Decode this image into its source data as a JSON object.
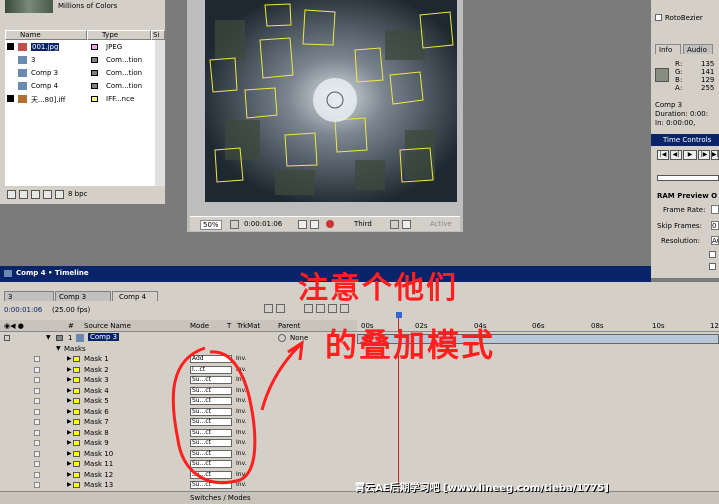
{
  "project": {
    "footage_info": "Millions of Colors",
    "col_name": "Name",
    "col_type": "Type",
    "col_size": "Si",
    "items": [
      {
        "name": "001.jpg",
        "type": "JPEG",
        "swatch": "#f0a0f0",
        "selected": true
      },
      {
        "name": "3",
        "type": "Com...tion",
        "swatch": "#808080"
      },
      {
        "name": "Comp 3",
        "type": "Com...tion",
        "swatch": "#808080"
      },
      {
        "name": "Comp 4",
        "type": "Com...tion",
        "swatch": "#808080"
      },
      {
        "name": "天...80].iff",
        "type": "IFF...nce",
        "swatch": "#f0f080"
      }
    ],
    "bpc": "8 bpc"
  },
  "comp": {
    "zoom": "50%",
    "timecode": "0:00:01:06",
    "resolution": "Third",
    "view": "Active"
  },
  "right": {
    "rotobezier": "RotoBezier",
    "tabs": [
      "Info",
      "Audio"
    ],
    "rgba": [
      {
        "ch": "R",
        "val": "135"
      },
      {
        "ch": "G",
        "val": "141"
      },
      {
        "ch": "B",
        "val": "129"
      },
      {
        "ch": "A",
        "val": "255"
      }
    ],
    "info_lines": [
      "Comp 3",
      "Duration: 0:00:",
      "In: 0:00:00,"
    ],
    "time_controls": "Time Controls",
    "ram_preview": "RAM Preview O",
    "frame_rate": "Frame Rate:",
    "skip_frames": "Skip Frames:",
    "skip_val": "0",
    "resolution": "Resolution:",
    "res_val": "Au"
  },
  "timeline": {
    "title": "Comp 4 • Timeline",
    "tabs": [
      "3",
      "Comp 3",
      "Comp 4"
    ],
    "timecode": "0:00:01:06",
    "fps": "(25.00 fps)",
    "headers": {
      "hash": "#",
      "source": "Source Name",
      "mode": "Mode",
      "t": "T",
      "trkmat": "TrkMat",
      "parent": "Parent"
    },
    "layer": {
      "num": "1",
      "name": "Comp 3",
      "parent": "None"
    },
    "masks_label": "Masks",
    "ruler": [
      "00s",
      "02s",
      "04s",
      "06s",
      "08s",
      "10s",
      "12"
    ],
    "masks": [
      {
        "name": "Mask 1",
        "mode": "Add",
        "inv": "Inv."
      },
      {
        "name": "Mask 2",
        "mode": "I...ct",
        "inv": "Inv."
      },
      {
        "name": "Mask 3",
        "mode": "Su...ct",
        "inv": "Inv."
      },
      {
        "name": "Mask 4",
        "mode": "Su...ct",
        "inv": "Inv."
      },
      {
        "name": "Mask 5",
        "mode": "Su...ct",
        "inv": "Inv."
      },
      {
        "name": "Mask 6",
        "mode": "Su...ct",
        "inv": "Inv."
      },
      {
        "name": "Mask 7",
        "mode": "Su...ct",
        "inv": "Inv."
      },
      {
        "name": "Mask 8",
        "mode": "Su...ct",
        "inv": "Inv."
      },
      {
        "name": "Mask 9",
        "mode": "Su...ct",
        "inv": "Inv."
      },
      {
        "name": "Mask 10",
        "mode": "Su...ct",
        "inv": "Inv."
      },
      {
        "name": "Mask 11",
        "mode": "Su...ct",
        "inv": "Inv."
      },
      {
        "name": "Mask 12",
        "mode": "Su...ct",
        "inv": "Inv."
      },
      {
        "name": "Mask 13",
        "mode": "Su...ct",
        "inv": "Inv."
      }
    ],
    "switches": "Switches / Modes"
  },
  "annotation": {
    "line1": "注意个他们",
    "line2": "的叠加模式",
    "color": "#ff1e1e"
  },
  "watermark": "霄云AE后期学习吧 [www.lineeg.com/tieba/1775]"
}
